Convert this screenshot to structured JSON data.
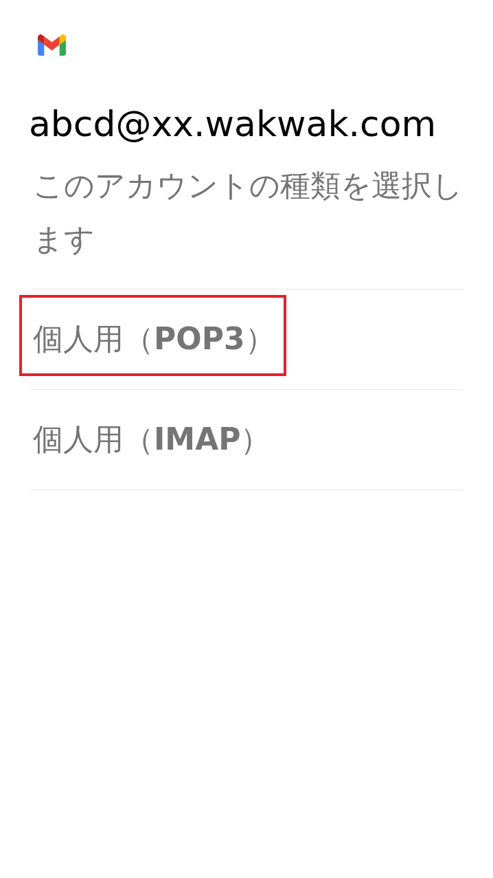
{
  "header": {
    "title": "abcd@xx.wakwak.com",
    "subtitle": "このアカウントの種類を選択します"
  },
  "options": [
    {
      "label": "個人用（**POP3**）",
      "highlighted": true
    },
    {
      "label": "個人用（**IMAP**）",
      "highlighted": false
    }
  ]
}
